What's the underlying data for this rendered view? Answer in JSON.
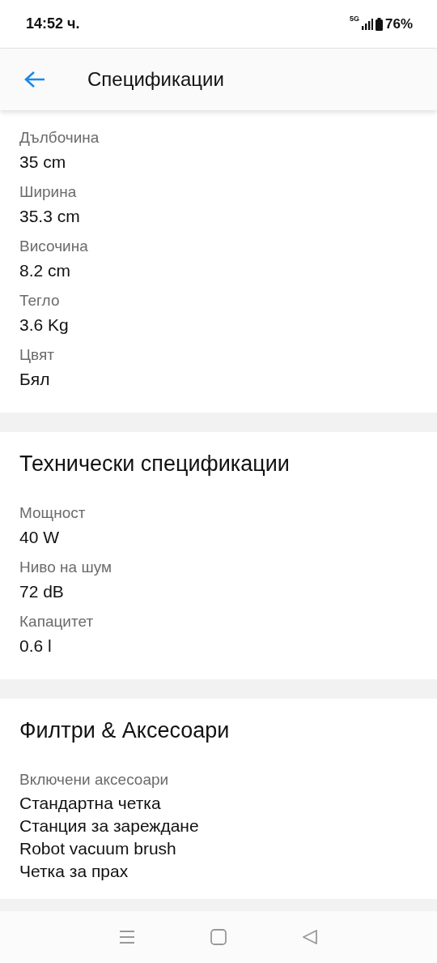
{
  "status_bar": {
    "time": "14:52 ч.",
    "network": "5G",
    "battery": "76%"
  },
  "header": {
    "title": "Спецификации"
  },
  "sections": [
    {
      "items": [
        {
          "label": "Дълбочина",
          "values": [
            "35 cm"
          ]
        },
        {
          "label": "Ширина",
          "values": [
            "35.3 cm"
          ]
        },
        {
          "label": "Височина",
          "values": [
            "8.2 cm"
          ]
        },
        {
          "label": "Тегло",
          "values": [
            "3.6 Kg"
          ]
        },
        {
          "label": "Цвят",
          "values": [
            "Бял"
          ]
        }
      ]
    },
    {
      "title": "Технически спецификации",
      "items": [
        {
          "label": "Мощност",
          "values": [
            "40 W"
          ]
        },
        {
          "label": "Ниво на шум",
          "values": [
            "72 dB"
          ]
        },
        {
          "label": "Капацитет",
          "values": [
            "0.6 l"
          ]
        }
      ]
    },
    {
      "title": "Филтри & Аксесоари",
      "items": [
        {
          "label": "Включени аксесоари",
          "values": [
            "Стандартна четка",
            "Станция за зареждане",
            "Robot vacuum brush",
            "Четка за прах"
          ]
        }
      ]
    }
  ]
}
